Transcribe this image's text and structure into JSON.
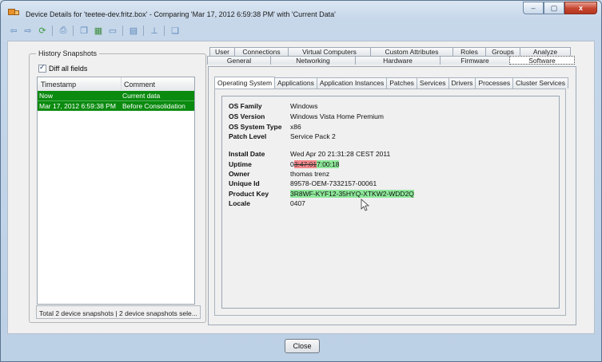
{
  "window": {
    "title": "Device Details for 'teetee-dev.fritz.box' - Comparing 'Mar 17, 2012 6:59:38 PM' with 'Current Data'",
    "controls": {
      "minimize": "–",
      "maximize": "▢",
      "close": "x"
    }
  },
  "history": {
    "group_title": "History Snapshots",
    "diff_label": "Diff all fields",
    "columns": [
      "Timestamp",
      "Comment"
    ],
    "rows": [
      {
        "timestamp": "Now",
        "comment": "Current data"
      },
      {
        "timestamp": "Mar 17, 2012 6:59:38 PM",
        "comment": "Before Consolidation"
      }
    ],
    "status": "Total 2 device snapshots | 2 device snapshots sele..."
  },
  "tabs_row1": [
    "User",
    "Connections",
    "Virtual Computers",
    "Custom Attributes",
    "Roles",
    "Groups",
    "Analyze"
  ],
  "tabs_row2": [
    "General",
    "Networking",
    "Hardware",
    "Firmware",
    "Software"
  ],
  "subtabs": [
    "Operating System",
    "Applications",
    "Application Instances",
    "Patches",
    "Services",
    "Drivers",
    "Processes",
    "Cluster Services"
  ],
  "os": {
    "family_label": "OS Family",
    "family": "Windows",
    "version_label": "OS Version",
    "version": "Windows Vista Home Premium",
    "type_label": "OS System Type",
    "type": "x86",
    "patch_label": "Patch Level",
    "patch": "Service Pack 2",
    "install_label": "Install Date",
    "install": "Wed Apr 20 21:31:28 CEST 2011",
    "uptime_label": "Uptime",
    "uptime_prefix": "0",
    "uptime_removed": "3:47:01",
    "uptime_added": "7:00:18",
    "owner_label": "Owner",
    "owner": "thomas trenz",
    "uid_label": "Unique Id",
    "uid": "89578-OEM-7332157-00061",
    "pkey_label": "Product Key",
    "pkey": "3R8WF-KYF12-35HYQ-XTKW2-WDD2Q",
    "locale_label": "Locale",
    "locale": "0407"
  },
  "buttons": {
    "close": "Close"
  }
}
